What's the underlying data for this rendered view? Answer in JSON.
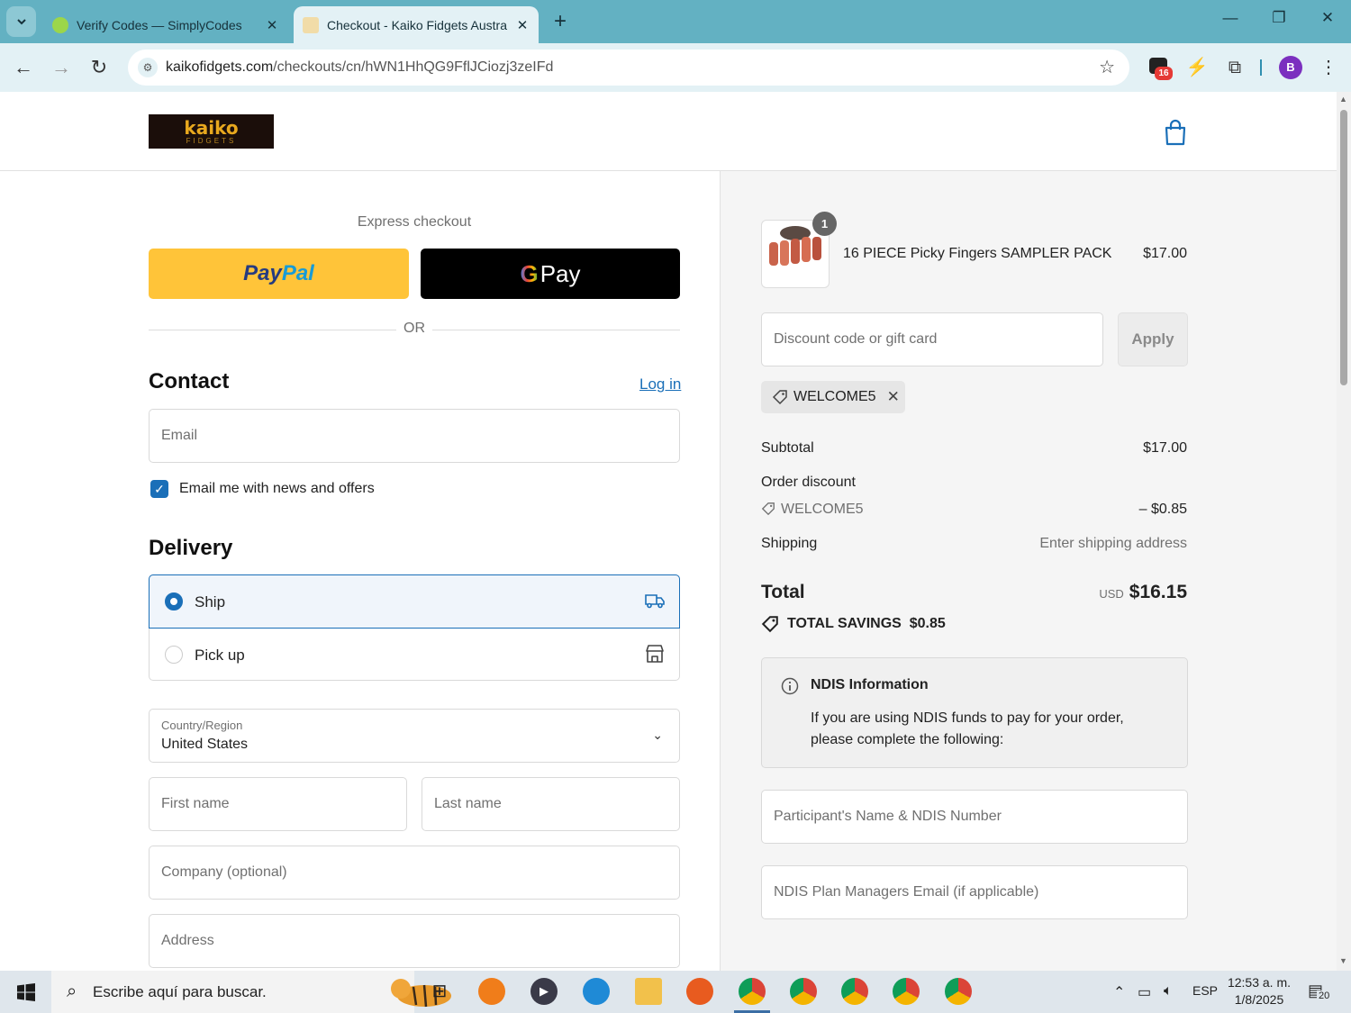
{
  "browser": {
    "tabs": [
      {
        "title": "Verify Codes — SimplyCodes",
        "active": false
      },
      {
        "title": "Checkout - Kaiko Fidgets Austra",
        "active": true
      }
    ],
    "url_domain": "kaikofidgets.com",
    "url_path": "/checkouts/cn/hWN1HhQG9FflJCiozj3zeIFd",
    "notification_badge": "16",
    "profile_initial": "B"
  },
  "store": {
    "logo_main": "kaiko",
    "logo_sub": "FIDGETS"
  },
  "checkout": {
    "express_label": "Express checkout",
    "paypal_a": "Pay",
    "paypal_b": "Pal",
    "gpay_g": "G",
    "gpay_label": "Pay",
    "or_label": "OR",
    "contact_heading": "Contact",
    "login_label": "Log in",
    "email_placeholder": "Email",
    "email_news_label": "Email me with news and offers",
    "email_news_checked": true,
    "delivery_heading": "Delivery",
    "delivery_options": [
      {
        "label": "Ship",
        "selected": true,
        "icon": "truck-icon"
      },
      {
        "label": "Pick up",
        "selected": false,
        "icon": "store-icon"
      }
    ],
    "country_label": "Country/Region",
    "country_value": "United States",
    "first_name_placeholder": "First name",
    "last_name_placeholder": "Last name",
    "company_placeholder": "Company (optional)",
    "address_placeholder": "Address"
  },
  "summary": {
    "product": {
      "name": "16 PIECE Picky Fingers SAMPLER PACK",
      "price": "$17.00",
      "quantity": "1"
    },
    "discount_placeholder": "Discount code or gift card",
    "apply_label": "Apply",
    "applied_code": "WELCOME5",
    "subtotal_label": "Subtotal",
    "subtotal_value": "$17.00",
    "order_discount_label": "Order discount",
    "discount_code": "WELCOME5",
    "discount_value": "– $0.85",
    "shipping_label": "Shipping",
    "shipping_value": "Enter shipping address",
    "total_label": "Total",
    "currency": "USD",
    "total_value": "$16.15",
    "savings_label": "TOTAL SAVINGS",
    "savings_value": "$0.85",
    "ndis_title": "NDIS Information",
    "ndis_text": "If you are using NDIS funds to pay for your order, please complete the following:",
    "ndis_participant_placeholder": "Participant's Name & NDIS Number",
    "ndis_manager_placeholder": "NDIS Plan Managers Email (if applicable)"
  },
  "taskbar": {
    "search_placeholder": "Escribe aquí para buscar.",
    "language": "ESP",
    "time": "12:53 a. m.",
    "date": "1/8/2025",
    "notification_count": "20"
  },
  "colors": {
    "accent": "#1a6fb8",
    "paypal": "#ffc439",
    "tabbar": "#63b1c2"
  }
}
